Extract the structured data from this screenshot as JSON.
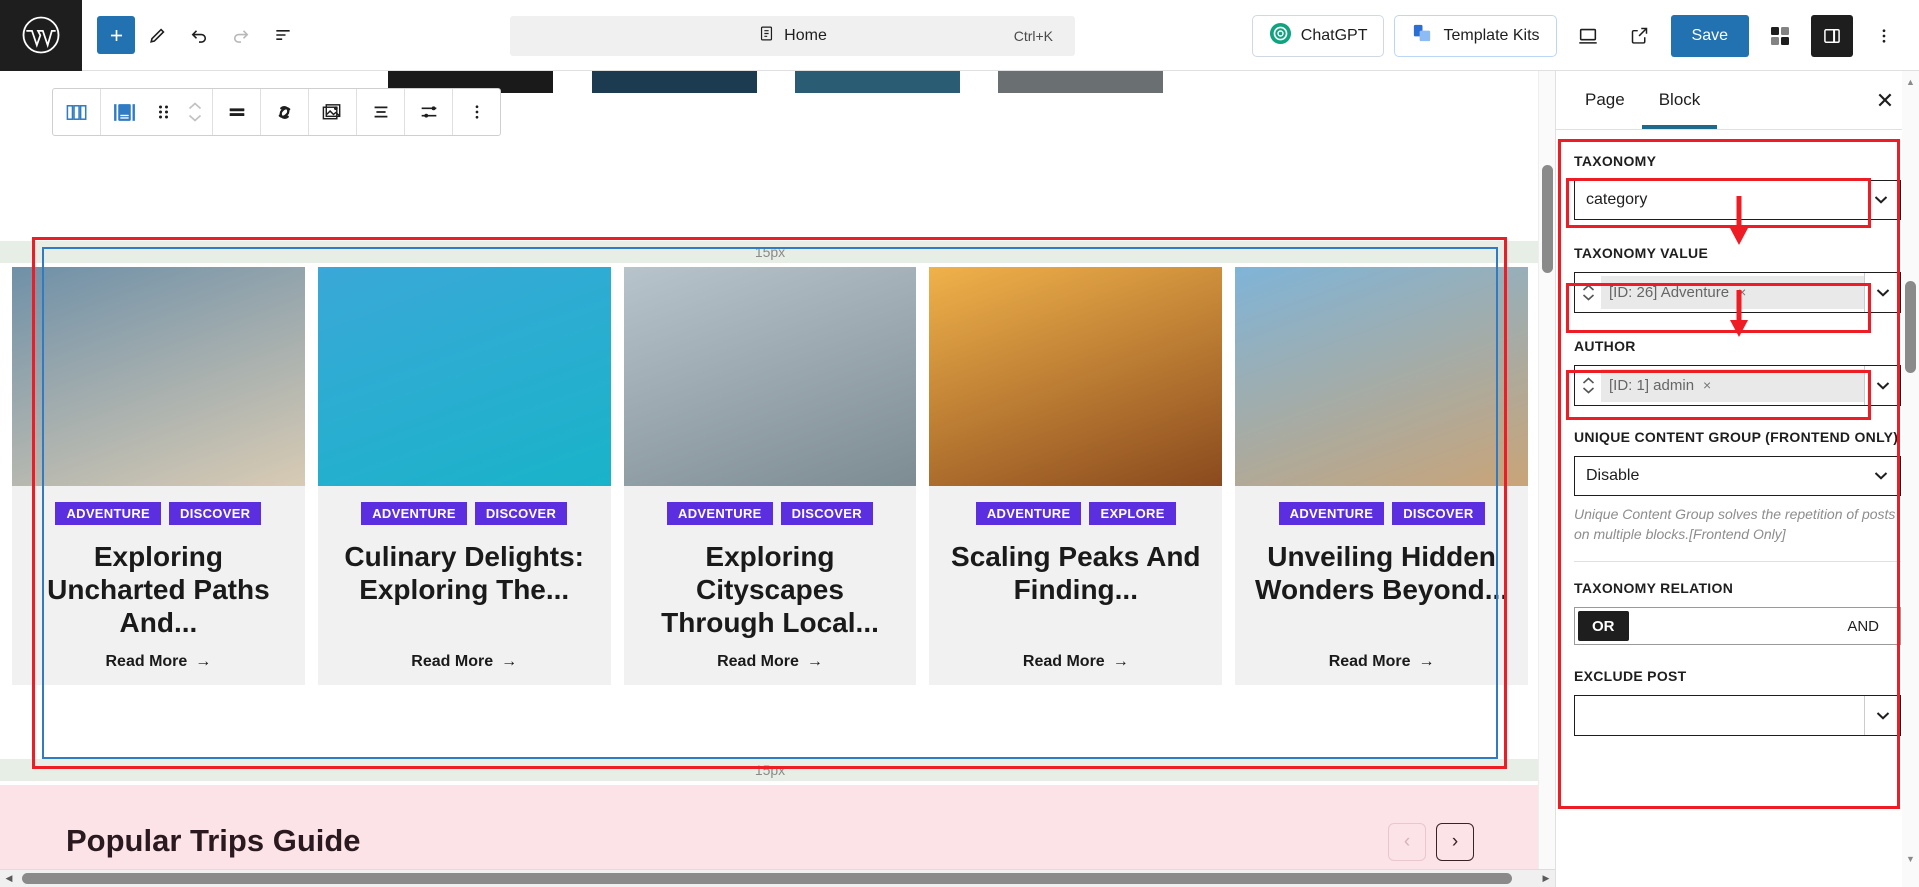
{
  "topbar": {
    "logo_icon": "wordpress-logo-icon",
    "tools": [
      {
        "name": "add-block-button",
        "icon": "plus-icon",
        "label": "+"
      },
      {
        "name": "edit-tool-button",
        "icon": "pencil-icon",
        "label": ""
      },
      {
        "name": "undo-button",
        "icon": "undo-arrow-icon",
        "label": ""
      },
      {
        "name": "redo-button",
        "icon": "redo-arrow-icon",
        "label": ""
      },
      {
        "name": "document-overview-button",
        "icon": "list-view-icon",
        "label": ""
      }
    ],
    "document_title": "Home",
    "document_icon": "page-icon",
    "shortcut": "Ctrl+K",
    "chatgpt_label": "ChatGPT",
    "template_kits_label": "Template Kits",
    "save_label": "Save",
    "view_icon": "desktop-preview-icon",
    "external_icon": "view-site-external-icon",
    "blocks_icon": "template-kits-grid-icon",
    "settings_icon": "sidebar-toggle-icon",
    "options_icon": "kebab-menu-icon",
    "accent_color": "#2271b1"
  },
  "block_toolbar": {
    "items": [
      {
        "name": "change-block-type-columns-button",
        "icon": "columns-icon"
      },
      {
        "name": "select-parent-block-button",
        "icon": "post-block-icon"
      },
      {
        "name": "drag-handle",
        "icon": "drag-dots-icon"
      },
      {
        "name": "move-block-updown",
        "icon": "chevron-up-down-icon"
      },
      {
        "name": "layout-button",
        "icon": "align-bar-icon"
      },
      {
        "name": "link-button",
        "icon": "link-icon"
      },
      {
        "name": "media-button",
        "icon": "image-stack-icon"
      },
      {
        "name": "align-text-button",
        "icon": "text-align-icon"
      },
      {
        "name": "settings-sliders-button",
        "icon": "sliders-icon"
      },
      {
        "name": "more-options-button",
        "icon": "kebab-menu-icon"
      }
    ]
  },
  "canvas": {
    "spacer_top_label": "15px",
    "spacer_bottom_label": "15px",
    "read_more_label": "Read More",
    "arrow_glyph": "→",
    "tag_color": "#5b2fe0",
    "posts": [
      {
        "tags": [
          "ADVENTURE",
          "DISCOVER"
        ],
        "title": "Exploring Uncharted Paths And...",
        "image_alt": "vintage-van-on-beach",
        "image_from": "#6f90a8",
        "image_to": "#d8cbb4"
      },
      {
        "tags": [
          "ADVENTURE",
          "DISCOVER"
        ],
        "title": "Culinary Delights: Exploring The...",
        "image_alt": "overwater-bungalows-tropical",
        "image_from": "#3aa8d8",
        "image_to": "#19b3c9"
      },
      {
        "tags": [
          "ADVENTURE",
          "DISCOVER"
        ],
        "title": "Exploring Cityscapes Through Local...",
        "image_alt": "person-arms-raised-on-mountain",
        "image_from": "#b8c4cc",
        "image_to": "#7d8b93"
      },
      {
        "tags": [
          "ADVENTURE",
          "EXPLORE"
        ],
        "title": "Scaling Peaks And Finding...",
        "image_alt": "silhouettes-at-sunset",
        "image_from": "#f0b24a",
        "image_to": "#8a4a1e"
      },
      {
        "tags": [
          "ADVENTURE",
          "DISCOVER"
        ],
        "title": "Unveiling Hidden Wonders Beyond...",
        "image_alt": "coastal-city-panorama",
        "image_from": "#7fb4d8",
        "image_to": "#c9a478"
      }
    ],
    "bottom_section": {
      "title": "Popular Trips Guide",
      "prev_label": "‹",
      "next_label": "›",
      "background": "#fbe3e8"
    }
  },
  "sidebar": {
    "tabs": [
      {
        "label": "Page",
        "name": "tab-page",
        "active": false
      },
      {
        "label": "Block",
        "name": "tab-block",
        "active": true
      }
    ],
    "close_label": "✕",
    "taxonomy": {
      "label": "TAXONOMY",
      "value": "category"
    },
    "taxonomy_value": {
      "label": "TAXONOMY VALUE",
      "token": "[ID: 26] Adventure",
      "remove_label": "×"
    },
    "author": {
      "label": "AUTHOR",
      "token": "[ID: 1] admin",
      "remove_label": "×"
    },
    "unique_content_group": {
      "label": "UNIQUE CONTENT GROUP (FRONTEND ONLY)",
      "value": "Disable",
      "help": "Unique Content Group solves the repetition of posts on multiple blocks.[Frontend Only]"
    },
    "taxonomy_relation": {
      "label": "TAXONOMY RELATION",
      "options": [
        "OR",
        "AND"
      ],
      "selected": "OR"
    },
    "exclude_post": {
      "label": "EXCLUDE POST",
      "value": ""
    }
  }
}
